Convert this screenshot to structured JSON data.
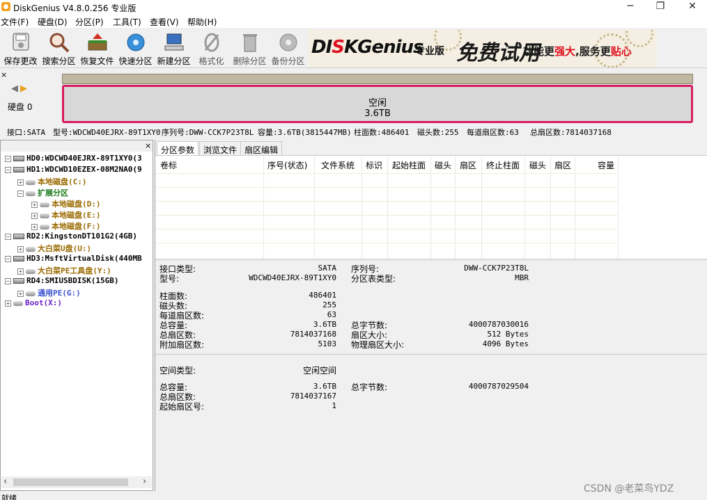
{
  "window": {
    "title": "DiskGenius V4.8.0.256 专业版",
    "minimize": "─",
    "restore": "❐",
    "close": "✕"
  },
  "menu": [
    "文件(F)",
    "硬盘(D)",
    "分区(P)",
    "工具(T)",
    "查看(V)",
    "帮助(H)"
  ],
  "toolbar": [
    {
      "label": "保存更改",
      "icon": "save-icon",
      "enabled": true
    },
    {
      "label": "搜索分区",
      "icon": "magnifier-icon",
      "enabled": true
    },
    {
      "label": "恢复文件",
      "icon": "restore-box-icon",
      "enabled": true
    },
    {
      "label": "快速分区",
      "icon": "disk-blue-icon",
      "enabled": true
    },
    {
      "label": "新建分区",
      "icon": "computer-icon",
      "enabled": true
    },
    {
      "label": "格式化",
      "icon": "format-icon",
      "enabled": false
    },
    {
      "label": "删除分区",
      "icon": "trash-icon",
      "enabled": false
    },
    {
      "label": "备份分区",
      "icon": "backup-disc-icon",
      "enabled": false
    }
  ],
  "banner": {
    "brand_a": "DI",
    "brand_b": "KGenius",
    "edition": "专业版",
    "free": "免费试用",
    "slogan_a": "功能更",
    "slogan_b": "强大",
    "slogan_c": ",服务更",
    "slogan_d": "贴心"
  },
  "disk_panel": {
    "close": "×",
    "nav": "‹ ›",
    "disk_label": "硬盘 0",
    "partition_name": "空闲",
    "partition_size": "3.6TB"
  },
  "infobar": {
    "interface": "接口:SATA",
    "model": "型号:WDCWD40EJRX-89T1XY0",
    "serial": "序列号:DWW-CCK7P23T8L",
    "capacity": "容量:3.6TB(3815447MB)",
    "cylinders": "柱面数:486401",
    "heads": "磁头数:255",
    "sectors_per_track": "每道扇区数:63",
    "total_sectors": "总扇区数:7814037168"
  },
  "tree": {
    "close": "×",
    "items": [
      {
        "text": "HD0:WDCWD40EJRX-89T1XY0(3",
        "color": "c-black",
        "level": 0,
        "exp": "-",
        "type": "disk"
      },
      {
        "text": "HD1:WDCWD10EZEX-08M2NA0(9",
        "color": "c-black",
        "level": 0,
        "exp": "-",
        "type": "disk"
      },
      {
        "text": "本地磁盘(C:)",
        "color": "c-brown",
        "level": 1,
        "exp": "+",
        "type": "part"
      },
      {
        "text": "扩展分区",
        "color": "c-green",
        "level": 1,
        "exp": "-",
        "type": "ext"
      },
      {
        "text": "本地磁盘(D:)",
        "color": "c-brown",
        "level": 2,
        "exp": "+",
        "type": "part"
      },
      {
        "text": "本地磁盘(E:)",
        "color": "c-brown",
        "level": 2,
        "exp": "+",
        "type": "part"
      },
      {
        "text": "本地磁盘(F:)",
        "color": "c-brown",
        "level": 2,
        "exp": "+",
        "type": "part"
      },
      {
        "text": "RD2:KingstonDT101G2(4GB)",
        "color": "c-black",
        "level": 0,
        "exp": "-",
        "type": "disk"
      },
      {
        "text": "大白菜U盘(U:)",
        "color": "c-brown",
        "level": 1,
        "exp": "+",
        "type": "part"
      },
      {
        "text": "HD3:MsftVirtualDisk(440MB",
        "color": "c-black",
        "level": 0,
        "exp": "-",
        "type": "disk"
      },
      {
        "text": "大白菜PE工具盘(Y:)",
        "color": "c-brown",
        "level": 1,
        "exp": "+",
        "type": "part"
      },
      {
        "text": "RD4:SMIUSBDISK(15GB)",
        "color": "c-black",
        "level": 0,
        "exp": "-",
        "type": "disk"
      },
      {
        "text": "通用PE(G:)",
        "color": "c-blue",
        "level": 1,
        "exp": "+",
        "type": "part"
      },
      {
        "text": "Boot(X:)",
        "color": "c-purple",
        "level": 0,
        "exp": "+",
        "type": "part"
      }
    ]
  },
  "tabs": [
    "分区参数",
    "浏览文件",
    "扇区编辑"
  ],
  "grid_headers": [
    "卷标",
    "序号(状态)",
    "文件系统",
    "标识",
    "起始柱面",
    "磁头",
    "扇区",
    "终止柱面",
    "磁头",
    "扇区",
    "容量"
  ],
  "details": {
    "interface_type_label": "接口类型:",
    "interface_type": "SATA",
    "model_label": "型号:",
    "model": "WDCWD40EJRX-89T1XY0",
    "serial_label": "序列号:",
    "serial": "DWW-CCK7P23T8L",
    "pt_type_label": "分区表类型:",
    "pt_type": "MBR",
    "cyl_label": "柱面数:",
    "cyl": "486401",
    "heads_label": "磁头数:",
    "heads": "255",
    "spt_label": "每道扇区数:",
    "spt": "63",
    "cap_label": "总容量:",
    "cap": "3.6TB",
    "bytes_label": "总字节数:",
    "bytes": "4000787030016",
    "tsec_label": "总扇区数:",
    "tsec": "7814037168",
    "secsize_label": "扇区大小:",
    "secsize": "512 Bytes",
    "extra_label": "附加扇区数:",
    "extra": "5103",
    "phys_label": "物理扇区大小:",
    "phys": "4096 Bytes",
    "space_type_label": "空间类型:",
    "space_type": "空闲空间",
    "free_cap_label": "总容量:",
    "free_cap": "3.6TB",
    "free_bytes_label": "总字节数:",
    "free_bytes": "4000787029504",
    "free_tsec_label": "总扇区数:",
    "free_tsec": "7814037167",
    "start_label": "起始扇区号:",
    "start": "1"
  },
  "status": "就绪",
  "watermark": "CSDN @老菜鸟YDZ"
}
